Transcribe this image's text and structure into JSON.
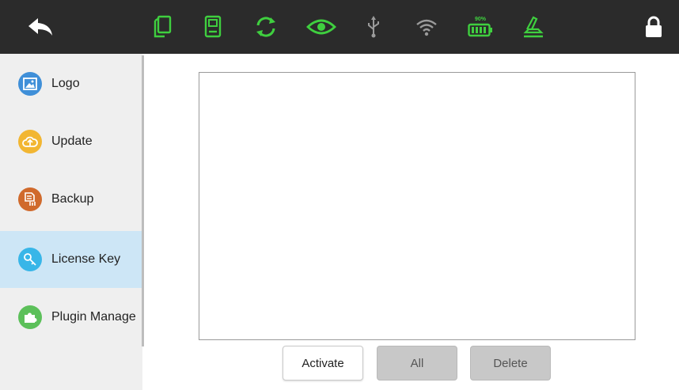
{
  "colors": {
    "topbar_bg": "#2b2b2b",
    "status_green": "#3fcf3f",
    "status_gray": "#9b9b9b",
    "sidebar_active_bg": "#cde6f6"
  },
  "topbar": {
    "back_icon": "back-arrow-icon",
    "status_icons": [
      "copy-icon",
      "device-icon",
      "sync-icon",
      "eye-icon",
      "usb-icon",
      "wifi-icon",
      "battery-icon",
      "printer-icon"
    ],
    "battery_level": "90%",
    "lock_icon": "lock-icon"
  },
  "sidebar": {
    "items": [
      {
        "label": "Logo",
        "icon": "image-icon",
        "color": "#3f8fd8",
        "active": false
      },
      {
        "label": "Update",
        "icon": "cloud-upload-icon",
        "color": "#f2b632",
        "active": false
      },
      {
        "label": "Backup",
        "icon": "backup-icon",
        "color": "#d06a2c",
        "active": false
      },
      {
        "label": "License Key",
        "icon": "key-icon",
        "color": "#38b6e8",
        "active": true
      },
      {
        "label": "Plugin Manage",
        "icon": "puzzle-icon",
        "color": "#5cc05a",
        "active": false
      }
    ]
  },
  "buttons": {
    "activate": "Activate",
    "all": "All",
    "delete": "Delete"
  }
}
